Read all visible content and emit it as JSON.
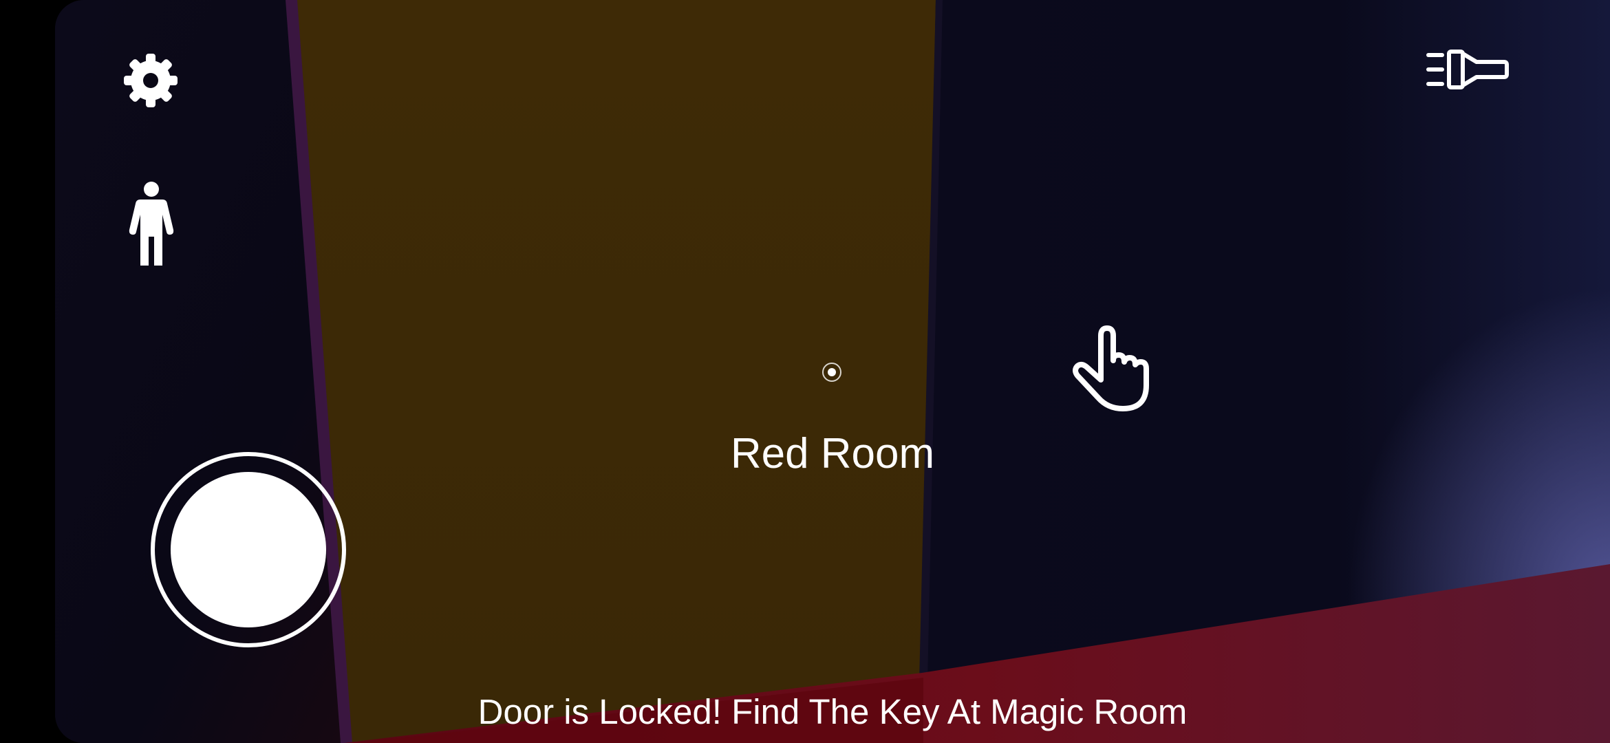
{
  "hud": {
    "room_label": "Red Room",
    "message": "Door is Locked! Find The Key At Magic Room"
  },
  "icons": {
    "settings": "gear-icon",
    "player": "person-standing-icon",
    "flashlight": "flashlight-icon",
    "interact": "hand-pointer-icon",
    "crosshair": "crosshair-dot-icon",
    "joystick": "joystick-knob"
  },
  "colors": {
    "door_panel": "#3d2a06",
    "wall": "#0a0816",
    "floor": "#6b0d1a",
    "glow": "#5a5ca0",
    "hud_white": "#ffffff"
  }
}
